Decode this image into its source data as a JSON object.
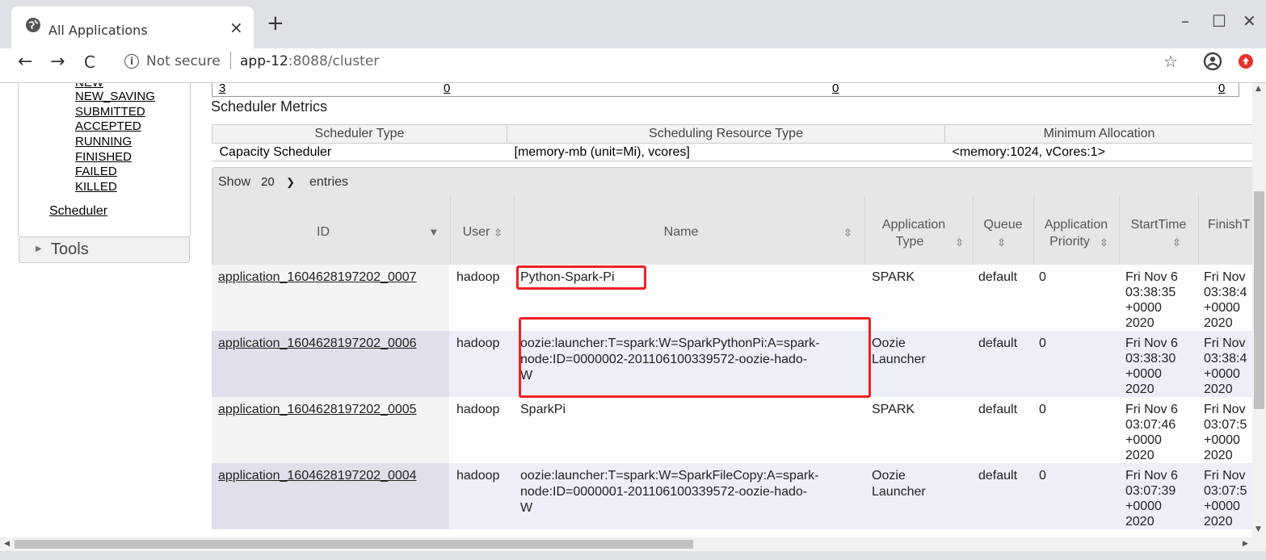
{
  "browser": {
    "tab_title": "All Applications",
    "tab_close": "×",
    "new_tab": "+",
    "win_min": "–",
    "win_max": "☐",
    "win_close": "✕",
    "back": "←",
    "forward": "→",
    "reload": "C",
    "not_secure": "Not secure",
    "url_host": "app-12",
    "url_rest": ":8088/cluster",
    "star": "☆"
  },
  "sidebar": {
    "states": [
      "NEW",
      "NEW_SAVING",
      "SUBMITTED",
      "ACCEPTED",
      "RUNNING",
      "FINISHED",
      "FAILED",
      "KILLED"
    ],
    "scheduler": "Scheduler",
    "tools": "Tools"
  },
  "top_stats": [
    "3",
    "0",
    "0",
    "0"
  ],
  "scheduler_metrics": {
    "title": "Scheduler Metrics",
    "headers": [
      "Scheduler Type",
      "Scheduling Resource Type",
      "Minimum Allocation"
    ],
    "row": [
      "Capacity Scheduler",
      "[memory-mb (unit=Mi), vcores]",
      "<memory:1024, vCores:1>"
    ]
  },
  "entries": {
    "show": "Show",
    "count": "20",
    "entries": "entries"
  },
  "apps_table": {
    "headers": {
      "id": "ID",
      "user": "User",
      "name": "Name",
      "type_l1": "Application",
      "type_l2": "Type",
      "queue_l1": "Queue",
      "priority_l1": "Application",
      "priority_l2": "Priority",
      "start": "StartTime",
      "finish": "FinishT"
    },
    "rows": [
      {
        "id": "application_1604628197202_0007",
        "user": "hadoop",
        "name_l1": "Python-Spark-Pi",
        "name_l2": "",
        "name_l3": "",
        "type_l1": "SPARK",
        "type_l2": "",
        "queue": "default",
        "priority": "0",
        "start": [
          "Fri Nov 6",
          "03:38:35",
          "+0000",
          "2020"
        ],
        "finish": [
          "Fri Nov",
          "03:38:4",
          "+0000",
          "2020"
        ]
      },
      {
        "id": "application_1604628197202_0006",
        "user": "hadoop",
        "name_l1": "oozie:launcher:T=spark:W=SparkPythonPi:A=spark-",
        "name_l2": "node:ID=0000002-201106100339572-oozie-hado-",
        "name_l3": "W",
        "type_l1": "Oozie",
        "type_l2": "Launcher",
        "queue": "default",
        "priority": "0",
        "start": [
          "Fri Nov 6",
          "03:38:30",
          "+0000",
          "2020"
        ],
        "finish": [
          "Fri Nov",
          "03:38:4",
          "+0000",
          "2020"
        ]
      },
      {
        "id": "application_1604628197202_0005",
        "user": "hadoop",
        "name_l1": "SparkPi",
        "name_l2": "",
        "name_l3": "",
        "type_l1": "SPARK",
        "type_l2": "",
        "queue": "default",
        "priority": "0",
        "start": [
          "Fri Nov 6",
          "03:07:46",
          "+0000",
          "2020"
        ],
        "finish": [
          "Fri Nov",
          "03:07:5",
          "+0000",
          "2020"
        ]
      },
      {
        "id": "application_1604628197202_0004",
        "user": "hadoop",
        "name_l1": "oozie:launcher:T=spark:W=SparkFileCopy:A=spark-",
        "name_l2": "node:ID=0000001-201106100339572-oozie-hado-",
        "name_l3": "W",
        "type_l1": "Oozie",
        "type_l2": "Launcher",
        "queue": "default",
        "priority": "0",
        "start": [
          "Fri Nov 6",
          "03:07:39",
          "+0000",
          "2020"
        ],
        "finish": [
          "Fri Nov",
          "03:07:5",
          "+0000",
          "2020"
        ]
      }
    ]
  },
  "colors": {
    "highlight": "#ee2222",
    "header_bg": "#e6e6e6",
    "row_even": "#eeeef9"
  }
}
